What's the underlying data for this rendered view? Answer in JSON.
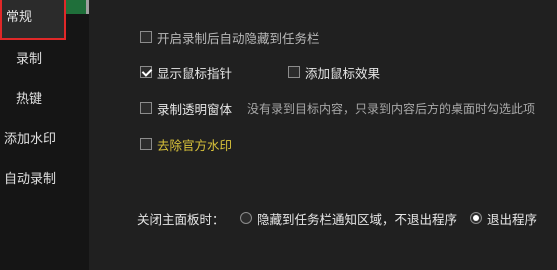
{
  "sidebar": {
    "items": [
      {
        "label": "常规",
        "active": true
      },
      {
        "label": "录制",
        "active": false
      },
      {
        "label": "热键",
        "active": false
      },
      {
        "label": "添加水印",
        "active": false
      },
      {
        "label": "自动录制",
        "active": false
      }
    ]
  },
  "general": {
    "hide_to_taskbar": {
      "label": "开启录制后自动隐藏到任务栏",
      "checked": false
    },
    "show_cursor": {
      "label": "显示鼠标指针",
      "checked": true
    },
    "cursor_effect": {
      "label": "添加鼠标效果",
      "checked": false
    },
    "transparent_window": {
      "label": "录制透明窗体",
      "checked": false
    },
    "transparent_hint": "没有录到目标内容，只录到内容后方的桌面时勾选此项",
    "remove_watermark": {
      "label": "去除官方水印",
      "checked": false
    },
    "close_panel_label": "关闭主面板时：",
    "close_options": [
      {
        "label": "隐藏到任务栏通知区域，不退出程序",
        "selected": false
      },
      {
        "label": "退出程序",
        "selected": true
      }
    ]
  },
  "colors": {
    "accent_border": "#e02828",
    "watermark_text": "#d8c23a"
  }
}
